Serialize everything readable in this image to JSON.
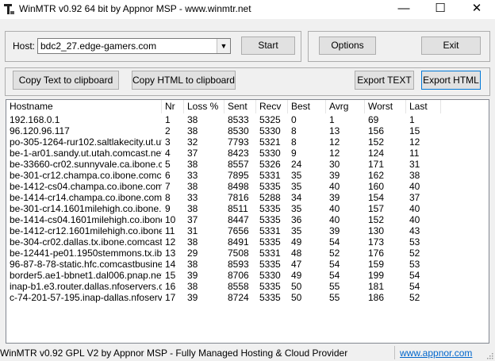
{
  "window": {
    "title": "WinMTR v0.92 64 bit by Appnor MSP - www.winmtr.net",
    "minimize_glyph": "—",
    "maximize_glyph": "☐",
    "close_glyph": "✕"
  },
  "host": {
    "label": "Host:",
    "value": "bdc2_27.edge-gamers.com",
    "dropdown_glyph": "▼"
  },
  "buttons": {
    "start": "Start",
    "options": "Options",
    "exit": "Exit",
    "copy_text": "Copy Text to clipboard",
    "copy_html": "Copy HTML to clipboard",
    "export_text": "Export TEXT",
    "export_html": "Export HTML"
  },
  "table": {
    "columns": [
      "Hostname",
      "Nr",
      "Loss %",
      "Sent",
      "Recv",
      "Best",
      "Avrg",
      "Worst",
      "Last"
    ],
    "rows": [
      [
        "192.168.0.1",
        "1",
        "38",
        "8533",
        "5325",
        "0",
        "1",
        "69",
        "1"
      ],
      [
        "96.120.96.117",
        "2",
        "38",
        "8530",
        "5330",
        "8",
        "13",
        "156",
        "15"
      ],
      [
        "po-305-1264-rur102.saltlakecity.ut.ut...",
        "3",
        "32",
        "7793",
        "5321",
        "8",
        "12",
        "152",
        "12"
      ],
      [
        "be-1-ar01.sandy.ut.utah.comcast.net",
        "4",
        "37",
        "8423",
        "5330",
        "9",
        "12",
        "124",
        "11"
      ],
      [
        "be-33660-cr02.sunnyvale.ca.ibone.c...",
        "5",
        "38",
        "8557",
        "5326",
        "24",
        "30",
        "171",
        "31"
      ],
      [
        "be-301-cr12.champa.co.ibone.comc...",
        "6",
        "33",
        "7895",
        "5331",
        "35",
        "39",
        "162",
        "38"
      ],
      [
        "be-1412-cs04.champa.co.ibone.com...",
        "7",
        "38",
        "8498",
        "5335",
        "35",
        "40",
        "160",
        "40"
      ],
      [
        "be-1414-cr14.champa.co.ibone.com...",
        "8",
        "33",
        "7816",
        "5288",
        "34",
        "39",
        "154",
        "37"
      ],
      [
        "be-301-cr14.1601milehigh.co.ibone.c...",
        "9",
        "38",
        "8511",
        "5335",
        "35",
        "40",
        "157",
        "40"
      ],
      [
        "be-1414-cs04.1601milehigh.co.ibone...",
        "10",
        "37",
        "8447",
        "5335",
        "36",
        "40",
        "152",
        "40"
      ],
      [
        "be-1412-cr12.1601milehigh.co.ibone...",
        "11",
        "31",
        "7656",
        "5331",
        "35",
        "39",
        "130",
        "43"
      ],
      [
        "be-304-cr02.dallas.tx.ibone.comcast....",
        "12",
        "38",
        "8491",
        "5335",
        "49",
        "54",
        "173",
        "53"
      ],
      [
        "be-12441-pe01.1950stemmons.tx.ibo...",
        "13",
        "29",
        "7508",
        "5331",
        "48",
        "52",
        "176",
        "52"
      ],
      [
        "96-87-8-78-static.hfc.comcastbusine...",
        "14",
        "38",
        "8593",
        "5335",
        "47",
        "54",
        "159",
        "53"
      ],
      [
        "border5.ae1-bbnet1.dal006.pnap.net",
        "15",
        "39",
        "8706",
        "5330",
        "49",
        "54",
        "199",
        "54"
      ],
      [
        "inap-b1.e3.router.dallas.nfoservers.c...",
        "16",
        "38",
        "8558",
        "5335",
        "50",
        "55",
        "181",
        "54"
      ],
      [
        "c-74-201-57-195.inap-dallas.nfoserve...",
        "17",
        "39",
        "8724",
        "5335",
        "50",
        "55",
        "186",
        "52"
      ]
    ]
  },
  "status": {
    "text": "WinMTR v0.92 GPL V2 by Appnor MSP - Fully Managed Hosting & Cloud Provider",
    "link": "www.appnor.com"
  }
}
